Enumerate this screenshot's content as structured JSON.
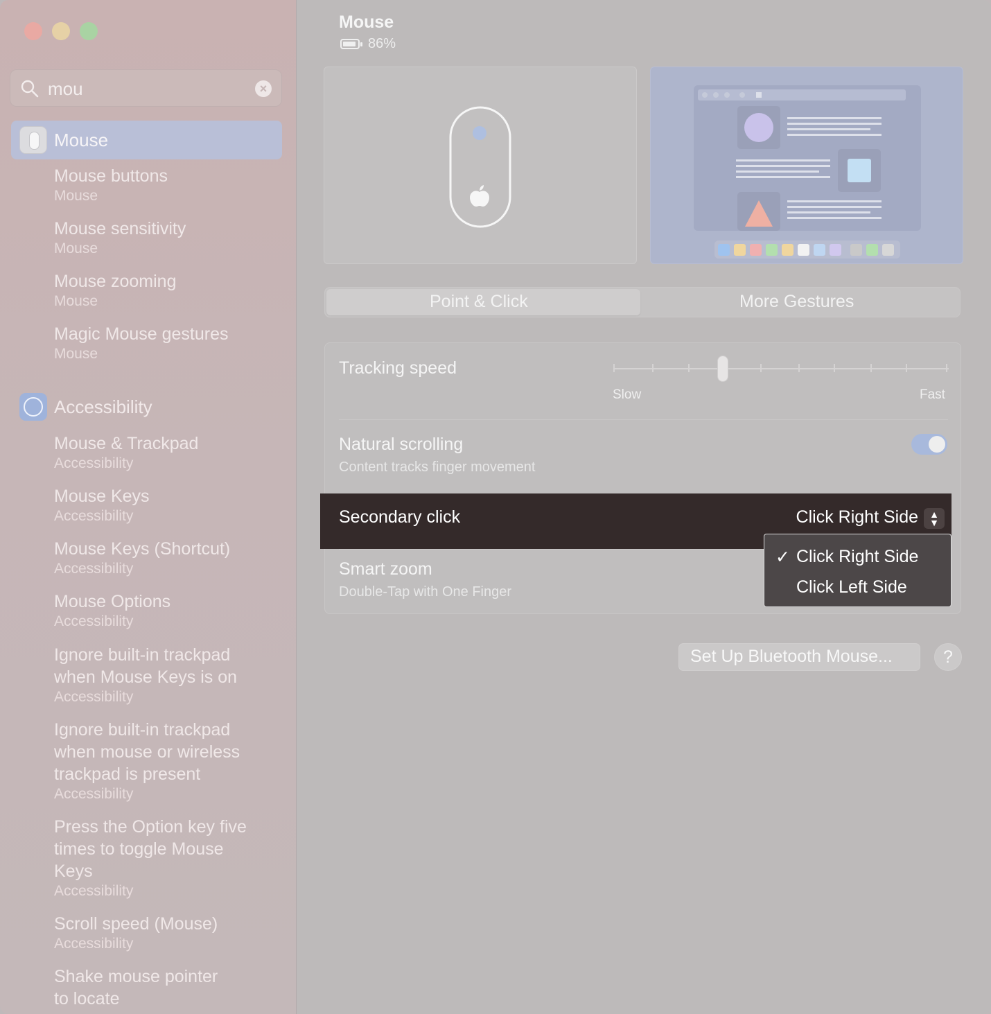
{
  "sidebar": {
    "search": {
      "value": "mou"
    },
    "selected": {
      "label": "Mouse"
    },
    "mouse_results": [
      {
        "title": "Mouse buttons",
        "sub": "Mouse"
      },
      {
        "title": "Mouse sensitivity",
        "sub": "Mouse"
      },
      {
        "title": "Mouse zooming",
        "sub": "Mouse"
      },
      {
        "title": "Magic Mouse gestures",
        "sub": "Mouse"
      }
    ],
    "accessibility_header": "Accessibility",
    "accessibility_results": [
      {
        "title": "Mouse & Trackpad",
        "sub": "Accessibility"
      },
      {
        "title": "Mouse Keys",
        "sub": "Accessibility"
      },
      {
        "title": "Mouse Keys (Shortcut)",
        "sub": "Accessibility"
      },
      {
        "title": "Mouse Options",
        "sub": "Accessibility"
      },
      {
        "title_lines": [
          "Ignore built-in trackpad",
          "when Mouse Keys is on"
        ],
        "sub": "Accessibility"
      },
      {
        "title_lines": [
          "Ignore built-in trackpad",
          "when mouse or wireless",
          "trackpad is present"
        ],
        "sub": "Accessibility"
      },
      {
        "title_lines": [
          "Press the Option key five",
          "times to toggle Mouse",
          "Keys"
        ],
        "sub": "Accessibility"
      },
      {
        "title": "Scroll speed (Mouse)",
        "sub": "Accessibility"
      },
      {
        "title_lines": [
          "Shake mouse pointer",
          "to locate"
        ]
      }
    ]
  },
  "main": {
    "title": "Mouse",
    "battery_text": "86%",
    "tabs": [
      {
        "label": "Point & Click",
        "active": true
      },
      {
        "label": "More Gestures",
        "active": false
      }
    ],
    "tracking": {
      "label": "Tracking speed",
      "slow_label": "Slow",
      "fast_label": "Fast",
      "level": 0.33
    },
    "natural_scrolling": {
      "label": "Natural scrolling",
      "sub": "Content tracks finger movement",
      "on": true
    },
    "secondary_click": {
      "label": "Secondary click",
      "value": "Click Right Side",
      "options": [
        {
          "label": "Click Right Side",
          "checked": true
        },
        {
          "label": "Click Left Side",
          "checked": false
        }
      ]
    },
    "smart_zoom": {
      "label": "Smart zoom",
      "sub": "Double-Tap with One Finger"
    },
    "bluetooth_button": "Set Up Bluetooth Mouse...",
    "help_button": "?"
  },
  "colors": {
    "highlight_row": "#342a2a",
    "selected_sidebar": "#b9bfd7",
    "toggle_on": "#a8b9dc"
  }
}
